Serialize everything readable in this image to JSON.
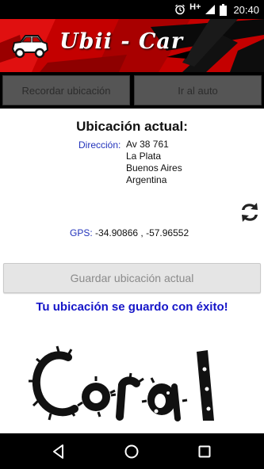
{
  "status_bar": {
    "network_label": "H+",
    "time": "20:40",
    "icons": [
      "alarm-icon",
      "signal-icon",
      "battery-icon"
    ]
  },
  "header": {
    "app_title": "Ubii - Car",
    "logo": "car-icon",
    "accent": "#cc0000"
  },
  "toolbar": {
    "remember_label": "Recordar ubicación",
    "goto_label": "Ir al auto"
  },
  "location": {
    "title": "Ubicación actual:",
    "address_label": "Dirección:",
    "address_lines": [
      "Av 38 761",
      "La Plata",
      "Buenos Aires",
      "Argentina"
    ],
    "gps_label": "GPS:",
    "gps_value": "-34.90866 , -57.96552",
    "refresh_icon": "refresh-icon"
  },
  "actions": {
    "save_label": "Guardar ubicación actual",
    "success_message": "Tu ubicación se guardo con éxito!"
  },
  "brand": {
    "text": "Coral"
  },
  "navbar": {
    "icons": [
      "back-icon",
      "home-icon",
      "recents-icon"
    ]
  }
}
